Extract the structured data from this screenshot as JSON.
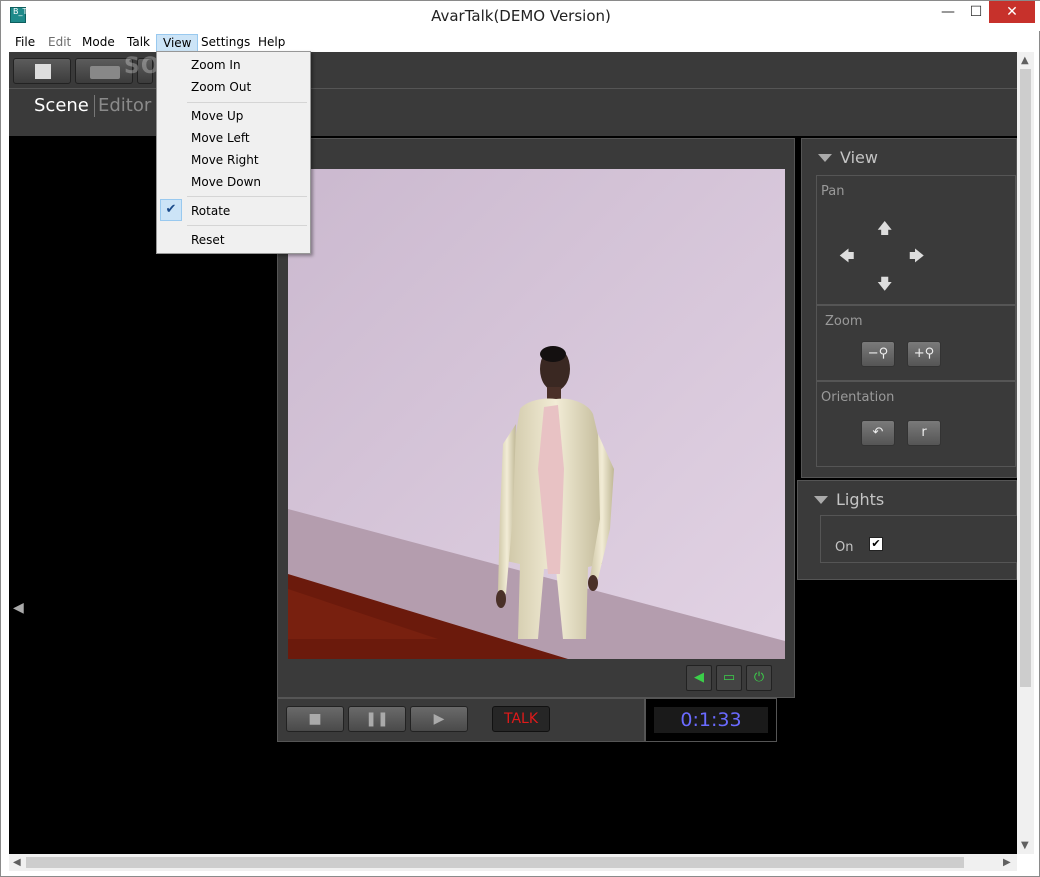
{
  "window": {
    "title": "AvarTalk(DEMO Version)",
    "icon_text": "B_T",
    "min_glyph": "—",
    "max_glyph": "☐",
    "close_glyph": "✕"
  },
  "menubar": {
    "items": [
      {
        "label": "File",
        "enabled": true
      },
      {
        "label": "Edit",
        "enabled": false
      },
      {
        "label": "Mode",
        "enabled": true
      },
      {
        "label": "Talk",
        "enabled": true
      },
      {
        "label": "View",
        "enabled": true,
        "active": true
      },
      {
        "label": "Settings",
        "enabled": true
      },
      {
        "label": "Help",
        "enabled": true
      }
    ]
  },
  "view_menu": {
    "items": [
      {
        "label": "Zoom In"
      },
      {
        "label": "Zoom Out"
      },
      {
        "label": "Move Up"
      },
      {
        "label": "Move Left"
      },
      {
        "label": "Move Right"
      },
      {
        "label": "Move Down"
      },
      {
        "label": "Rotate",
        "checked": true
      },
      {
        "label": "Reset"
      }
    ],
    "check_glyph": "✔"
  },
  "watermark": "SOFTPEDIA",
  "tabs": {
    "scene": "Scene",
    "editor": "Editor"
  },
  "view_panel": {
    "title": "View",
    "pan_label": "Pan",
    "arrows": {
      "up": "🡅",
      "down": "🡇",
      "left": "🡄",
      "right": "🡆"
    },
    "zoom_label": "Zoom",
    "zoom_out_glyph": "−⚲",
    "zoom_in_glyph": "+⚲",
    "orientation_label": "Orientation",
    "rotate_glyph": "↶",
    "reset_glyph": "r"
  },
  "lights_panel": {
    "title": "Lights",
    "on_label": "On",
    "on_checked": true,
    "check_glyph": "✔"
  },
  "viewport_controls": {
    "sound_glyph": "◀",
    "screen_glyph": "▭",
    "power_glyph": "⏻"
  },
  "playback": {
    "stop_glyph": "■",
    "pause_glyph": "❚❚",
    "play_glyph": "▶",
    "talk_label": "TALK",
    "timer": "0:1:33"
  },
  "colors": {
    "accent_talk": "#e01a1a",
    "timer": "#6a6aff",
    "panel_bg": "#3a3a3a",
    "green_icons": "#3bd04a"
  },
  "scroll_glyphs": {
    "up": "▲",
    "down": "▼",
    "left": "◀",
    "right": "▶",
    "scene_left": "◀"
  }
}
